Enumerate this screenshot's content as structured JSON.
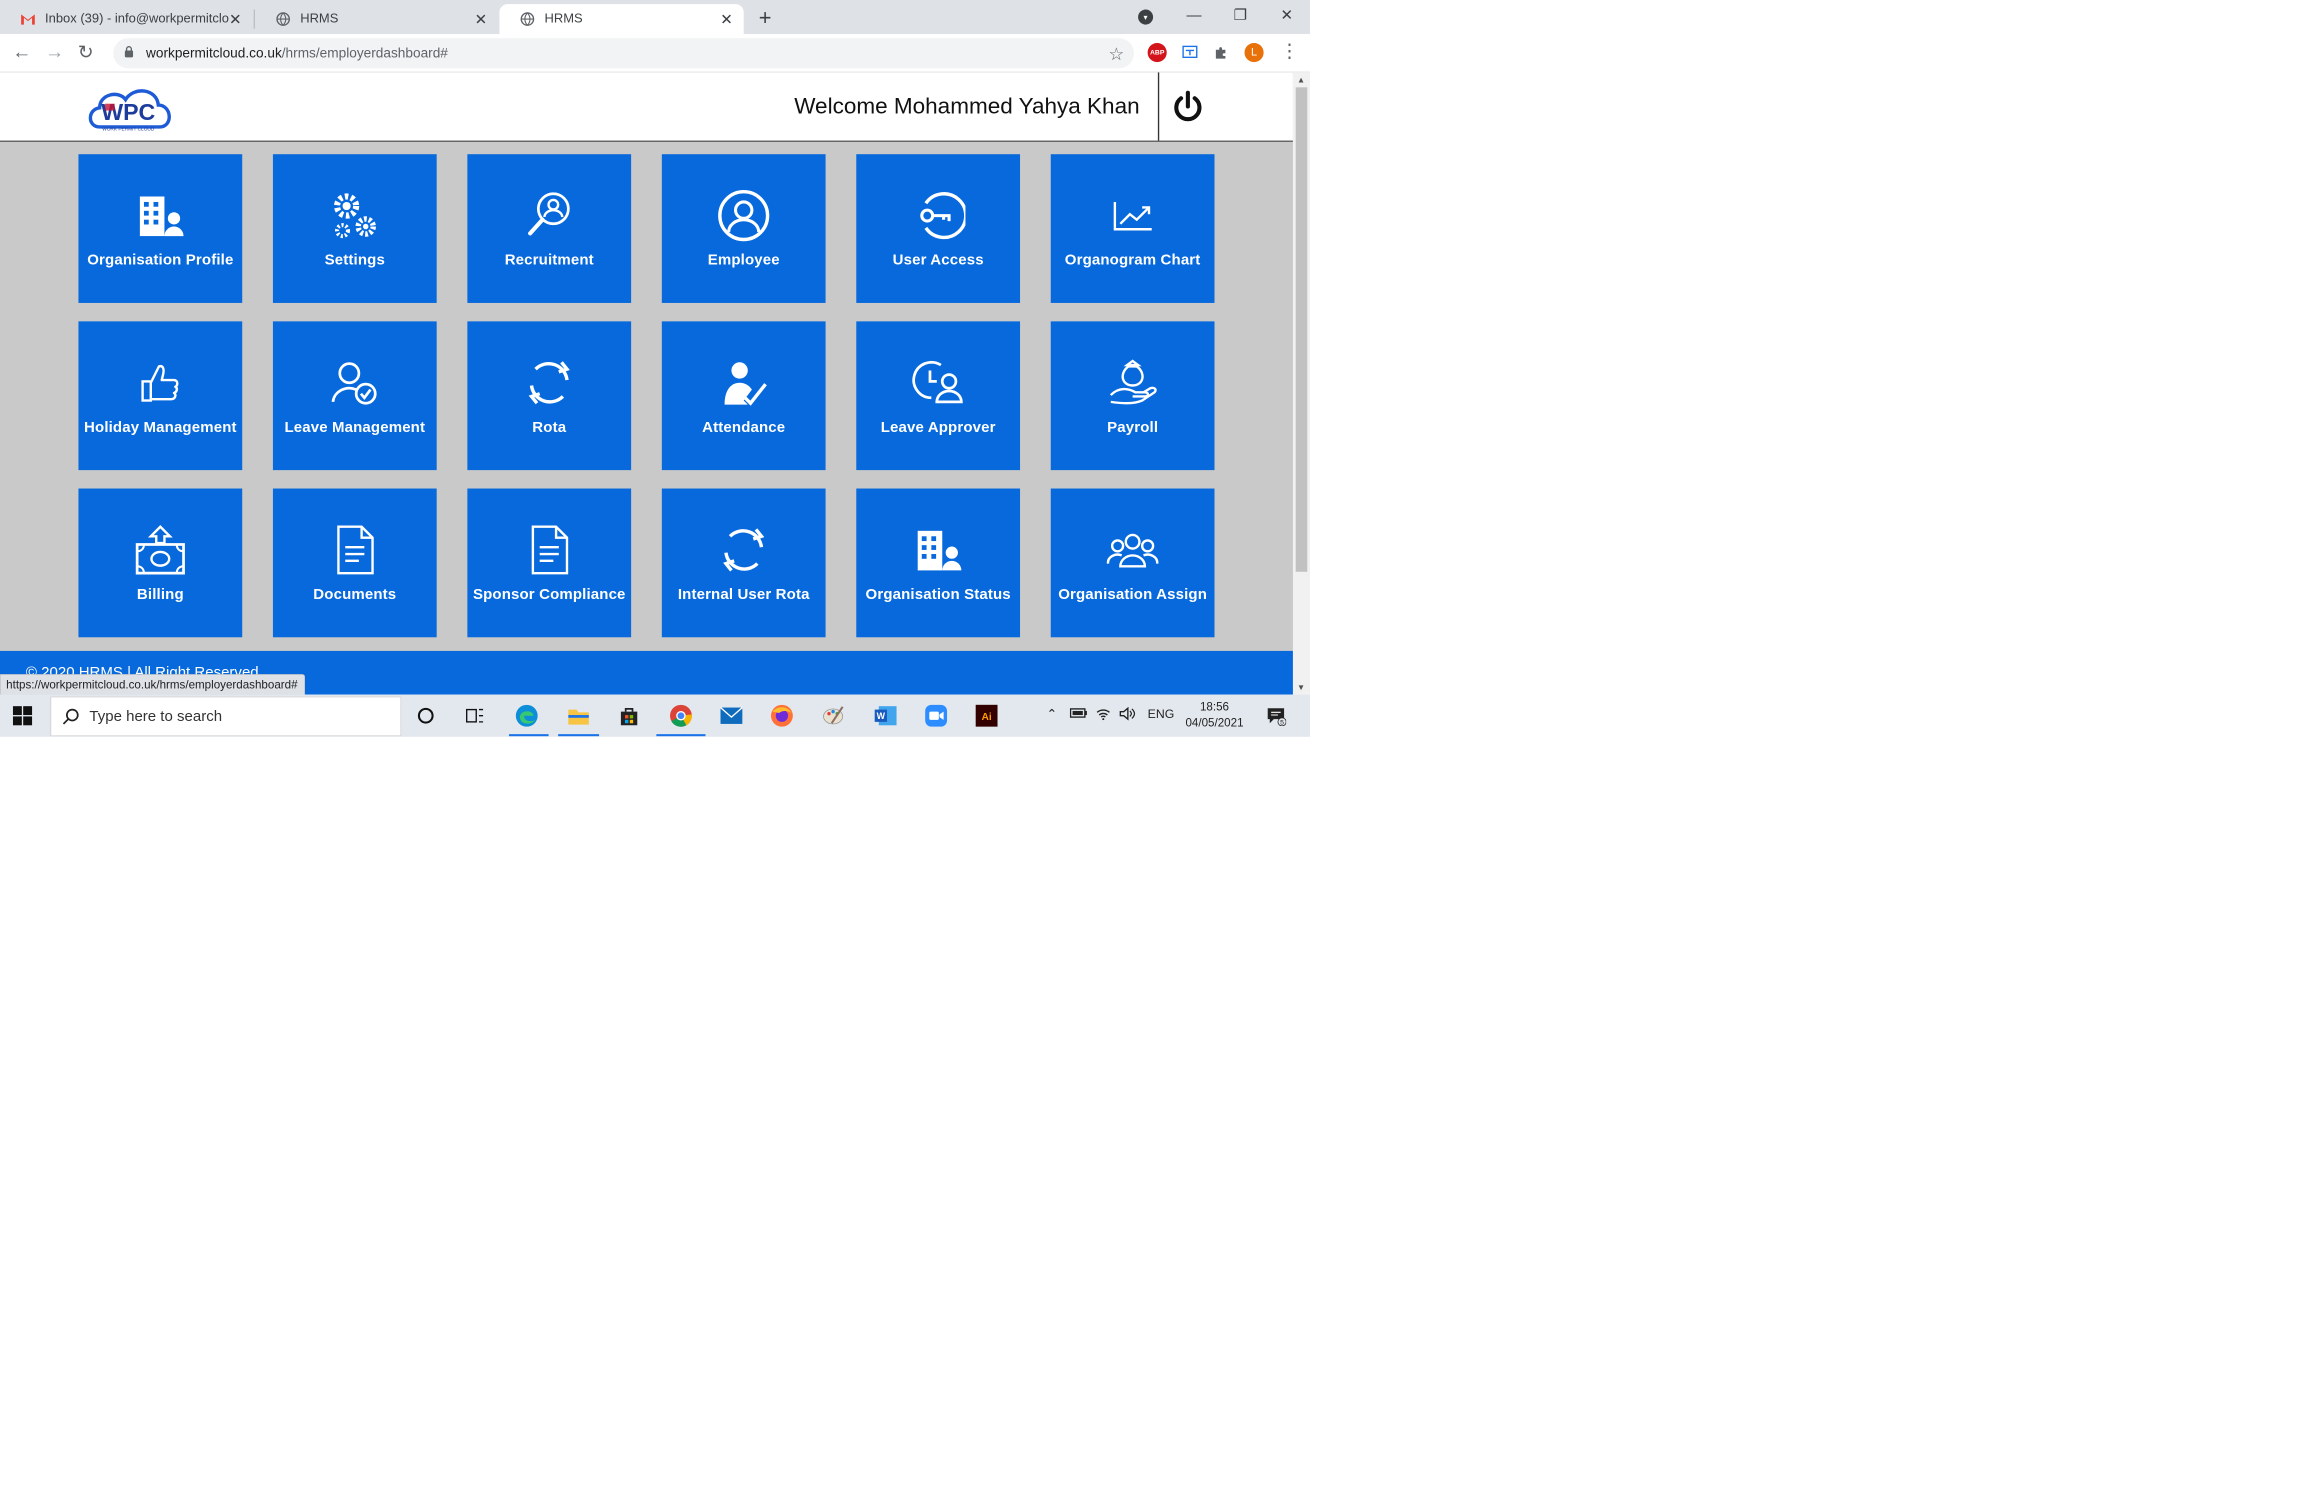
{
  "browser": {
    "tabs": [
      {
        "title": "Inbox (39) - info@workpermitclo",
        "icon": "gmail-icon"
      },
      {
        "title": "HRMS",
        "icon": "globe-icon"
      },
      {
        "title": "HRMS",
        "icon": "globe-icon"
      }
    ],
    "url_host": "workpermitcloud.co.uk",
    "url_path": "/hrms/employerdashboard#",
    "profile_initial": "L",
    "abp_label": "ABP"
  },
  "header": {
    "logo_text": "WPC",
    "logo_subtext": "WORK PERMIT CLOUD",
    "welcome": "Welcome Mohammed Yahya Khan"
  },
  "tiles": [
    {
      "label": "Organisation Profile",
      "icon": "building-user-icon"
    },
    {
      "label": "Settings",
      "icon": "gears-icon"
    },
    {
      "label": "Recruitment",
      "icon": "search-user-icon"
    },
    {
      "label": "Employee",
      "icon": "user-circle-icon"
    },
    {
      "label": "User Access",
      "icon": "key-icon"
    },
    {
      "label": "Organogram Chart",
      "icon": "trend-chart-icon"
    },
    {
      "label": "Holiday Management",
      "icon": "thumbs-up-icon"
    },
    {
      "label": "Leave Management",
      "icon": "user-check-icon"
    },
    {
      "label": "Rota",
      "icon": "refresh-icon"
    },
    {
      "label": "Attendance",
      "icon": "user-tick-icon"
    },
    {
      "label": "Leave Approver",
      "icon": "clock-user-icon"
    },
    {
      "label": "Payroll",
      "icon": "money-hand-icon"
    },
    {
      "label": "Billing",
      "icon": "money-upload-icon"
    },
    {
      "label": "Documents",
      "icon": "document-icon"
    },
    {
      "label": "Sponsor Compliance",
      "icon": "document-icon"
    },
    {
      "label": "Internal User Rota",
      "icon": "refresh-icon"
    },
    {
      "label": "Organisation Status",
      "icon": "building-user-icon"
    },
    {
      "label": "Organisation Assign",
      "icon": "users-group-icon"
    }
  ],
  "footer": {
    "text": "© 2020 HRMS | All Right Reserved"
  },
  "status_bar": {
    "url": "https://workpermitcloud.co.uk/hrms/employerdashboard#"
  },
  "taskbar": {
    "search_placeholder": "Type here to search",
    "lang": "ENG",
    "time": "18:56",
    "date": "04/05/2021",
    "notifications": "5"
  },
  "colors": {
    "tile_blue": "#0769dc",
    "page_gray": "#c9c9c9"
  }
}
